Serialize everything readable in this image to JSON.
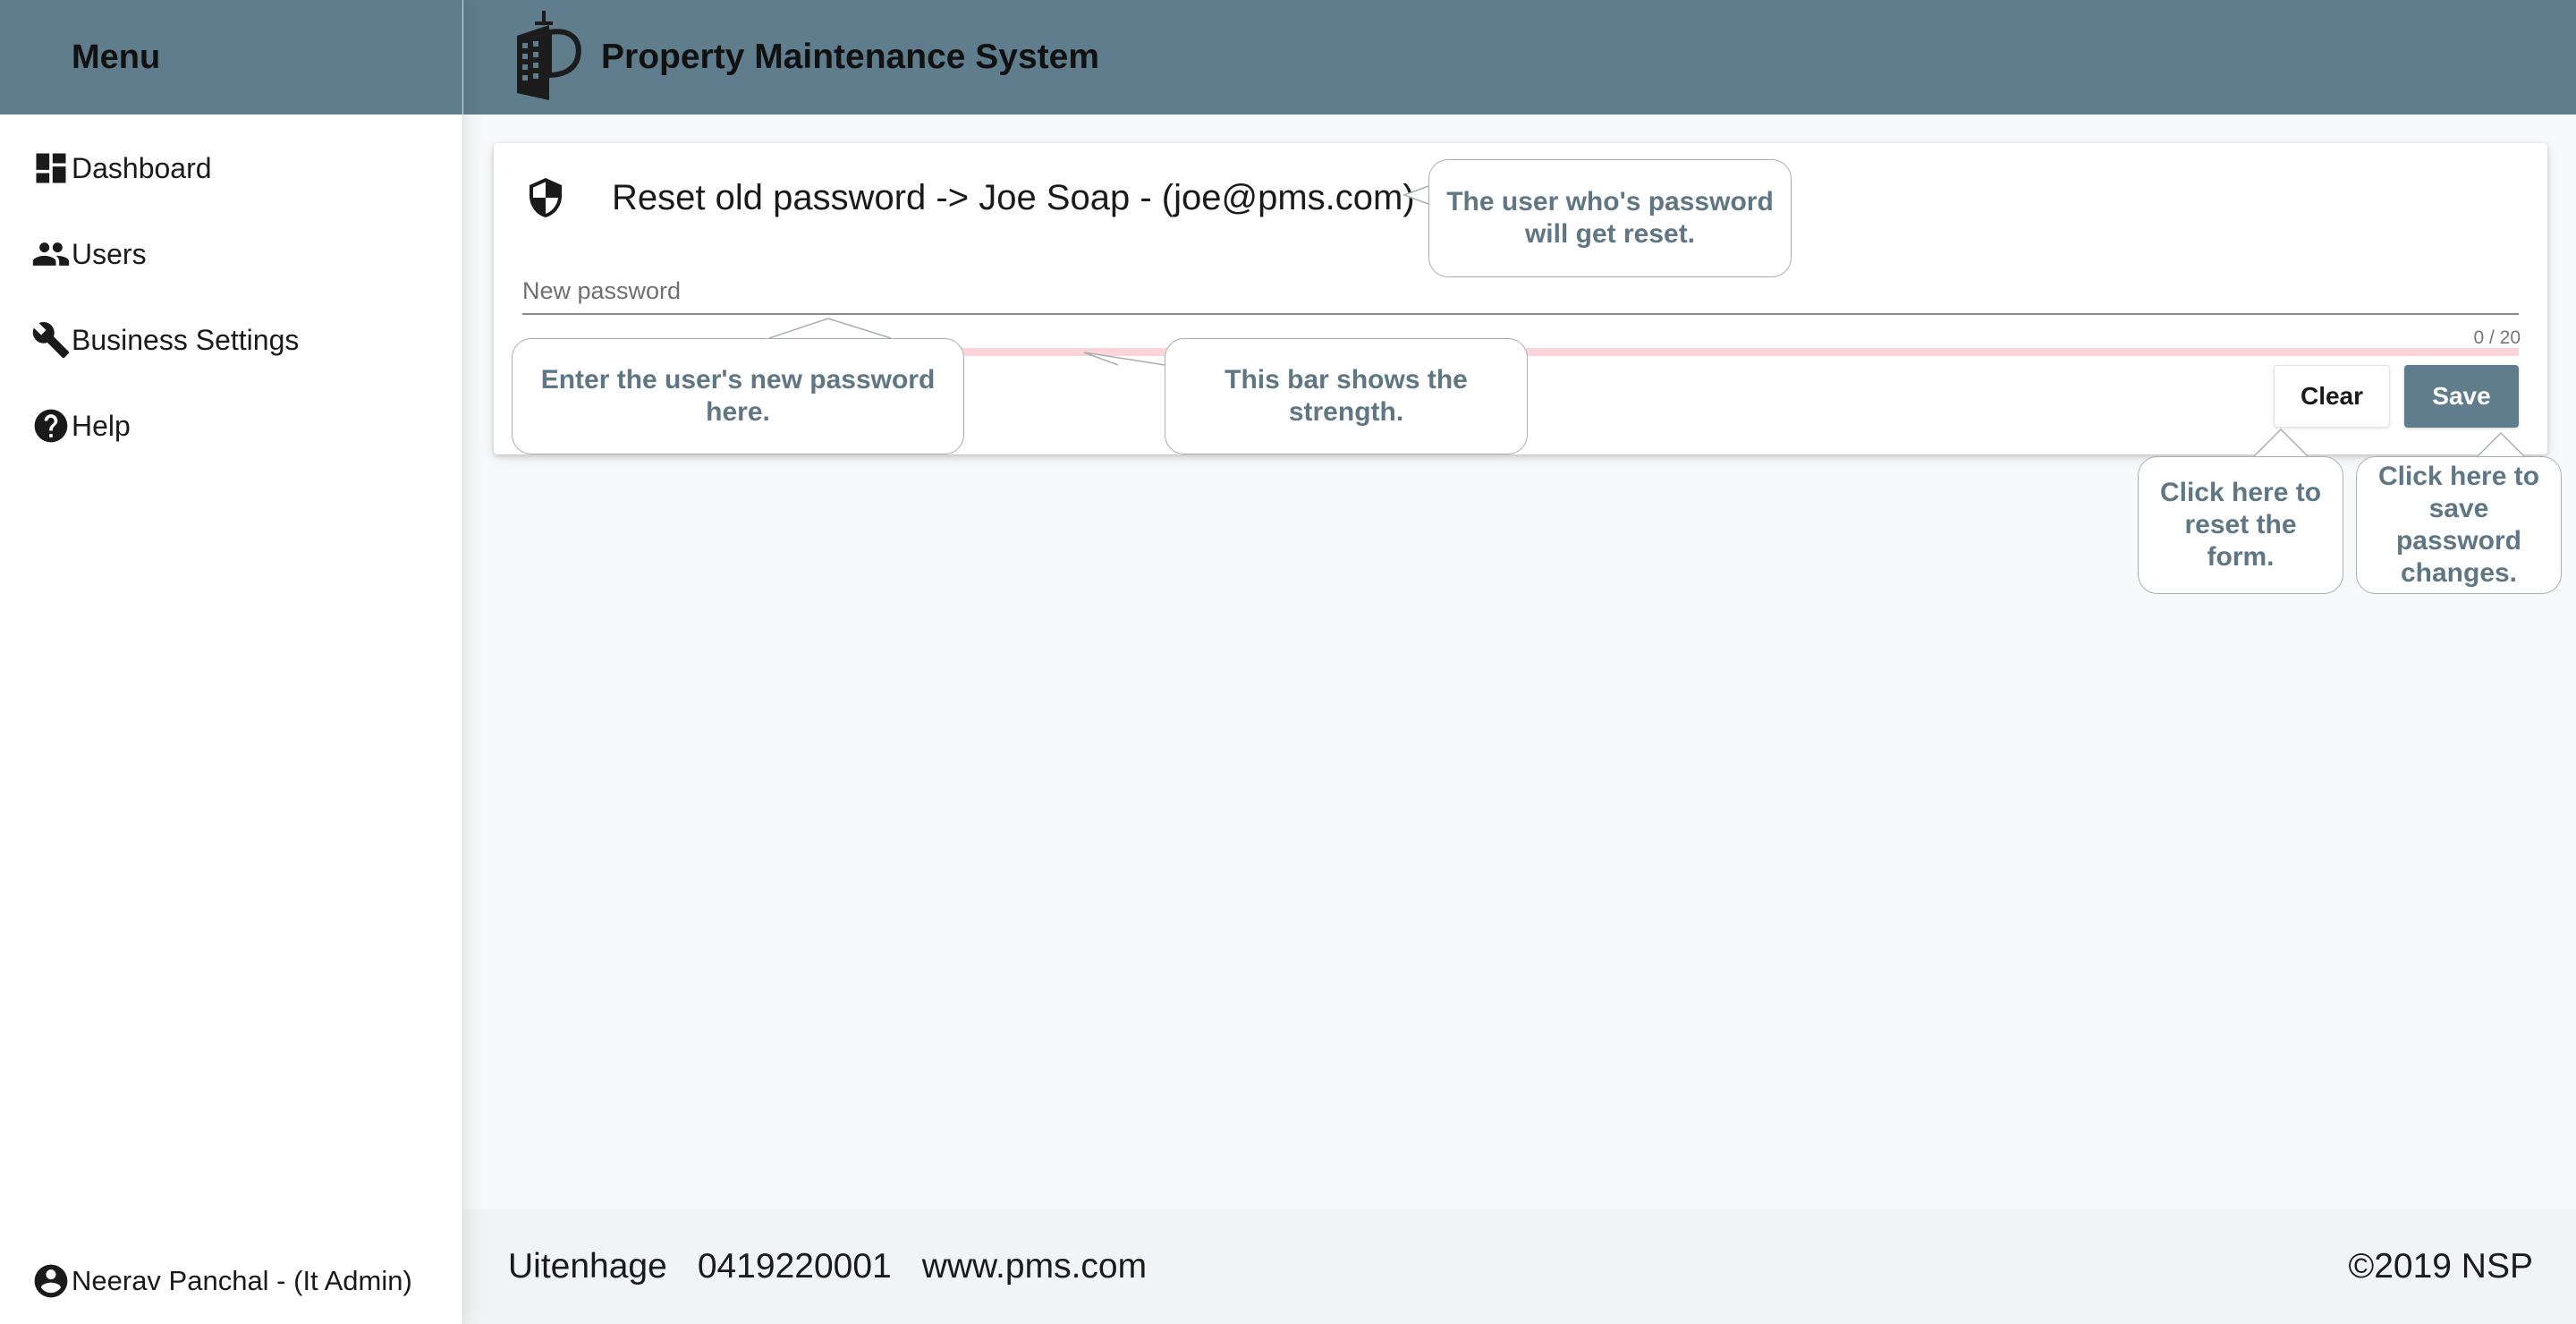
{
  "sidebar": {
    "title": "Menu",
    "items": [
      {
        "label": "Dashboard",
        "icon": "dashboard-icon"
      },
      {
        "label": "Users",
        "icon": "users-icon"
      },
      {
        "label": "Business Settings",
        "icon": "wrench-icon"
      },
      {
        "label": "Help",
        "icon": "help-icon"
      }
    ],
    "user": {
      "label": "Neerav Panchal - (It Admin)",
      "icon": "account-circle-icon"
    }
  },
  "header": {
    "title": "Property Maintenance System",
    "logo": "building-logo"
  },
  "card": {
    "title": "Reset old password -> Joe Soap - (joe@pms.com)",
    "icon": "shield-icon",
    "password_field": {
      "label": "New password",
      "value": "",
      "counter": "0 / 20"
    },
    "strength": {
      "value": 0
    },
    "clear_label": "Clear",
    "save_label": "Save"
  },
  "callouts": {
    "user": "The user who's password will get reset.",
    "input": "Enter the user's new password here.",
    "bar": "This bar shows the strength.",
    "clear": "Click here to reset the form.",
    "save": "Click here to save password changes."
  },
  "footer": {
    "city": "Uitenhage",
    "phone": "0419220001",
    "website": "www.pms.com",
    "copyright": "©2019 NSP"
  },
  "colors": {
    "primary": "#5f7d8c",
    "callout_text": "#5f7685",
    "strength_track": "#fcd4da"
  }
}
